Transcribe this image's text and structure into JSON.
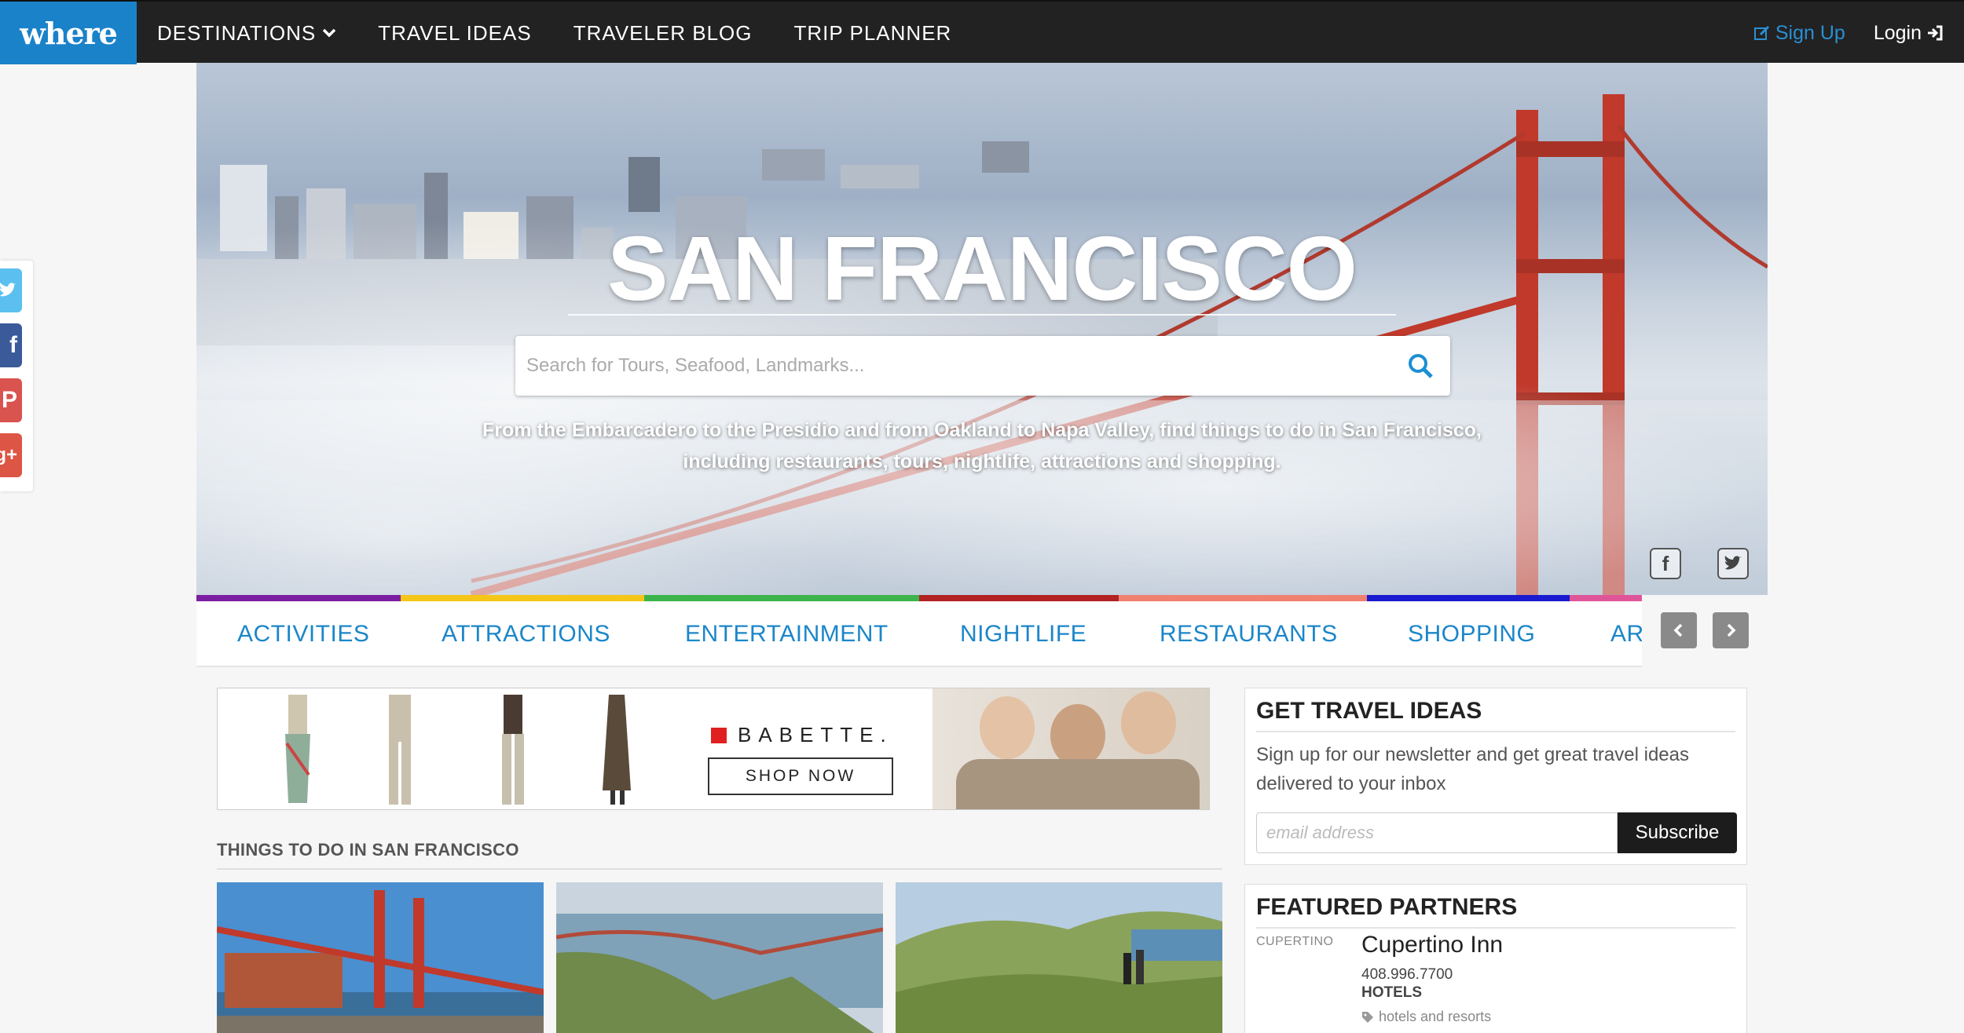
{
  "nav": {
    "logo": "where",
    "links": [
      "DESTINATIONS",
      "TRAVEL IDEAS",
      "TRAVELER BLOG",
      "TRIP PLANNER"
    ],
    "signup": "Sign Up",
    "login": "Login"
  },
  "social_left": [
    "twitter-icon",
    "facebook-icon",
    "pinterest-icon",
    "google-plus-icon"
  ],
  "hero": {
    "title": "SAN FRANCISCO",
    "search_placeholder": "Search for Tours, Seafood, Landmarks...",
    "tagline_line1": "From the Embarcadero to the Presidio and from Oakland to Napa Valley, find things to do in San Francisco,",
    "tagline_line2": "including restaurants, tours, nightlife, attractions and shopping."
  },
  "stripe_colors": [
    "#7b1fa2",
    "#f5c518",
    "#3cb44b",
    "#b22222",
    "#f08070",
    "#1a1ad0",
    "#e0559a"
  ],
  "categories": [
    "ACTIVITIES",
    "ATTRACTIONS",
    "ENTERTAINMENT",
    "NIGHTLIFE",
    "RESTAURANTS",
    "SHOPPING",
    "AR"
  ],
  "ad": {
    "brand": "BABETTE.",
    "cta": "SHOP NOW"
  },
  "things": {
    "title": "THINGS TO DO IN SAN FRANCISCO"
  },
  "newsletter": {
    "title": "GET TRAVEL IDEAS",
    "text": "Sign up for our newsletter and get great travel ideas delivered to your inbox",
    "email_placeholder": "email address",
    "button": "Subscribe"
  },
  "partners": {
    "title": "FEATURED PARTNERS",
    "logo_text": "CUPERTINO",
    "name": "Cupertino Inn",
    "phone": "408.996.7700",
    "category": "HOTELS",
    "tag": "hotels and resorts"
  },
  "colors": {
    "brand_blue": "#1a82c9",
    "nav_dark": "#222222",
    "link_blue": "#1b86c9"
  }
}
